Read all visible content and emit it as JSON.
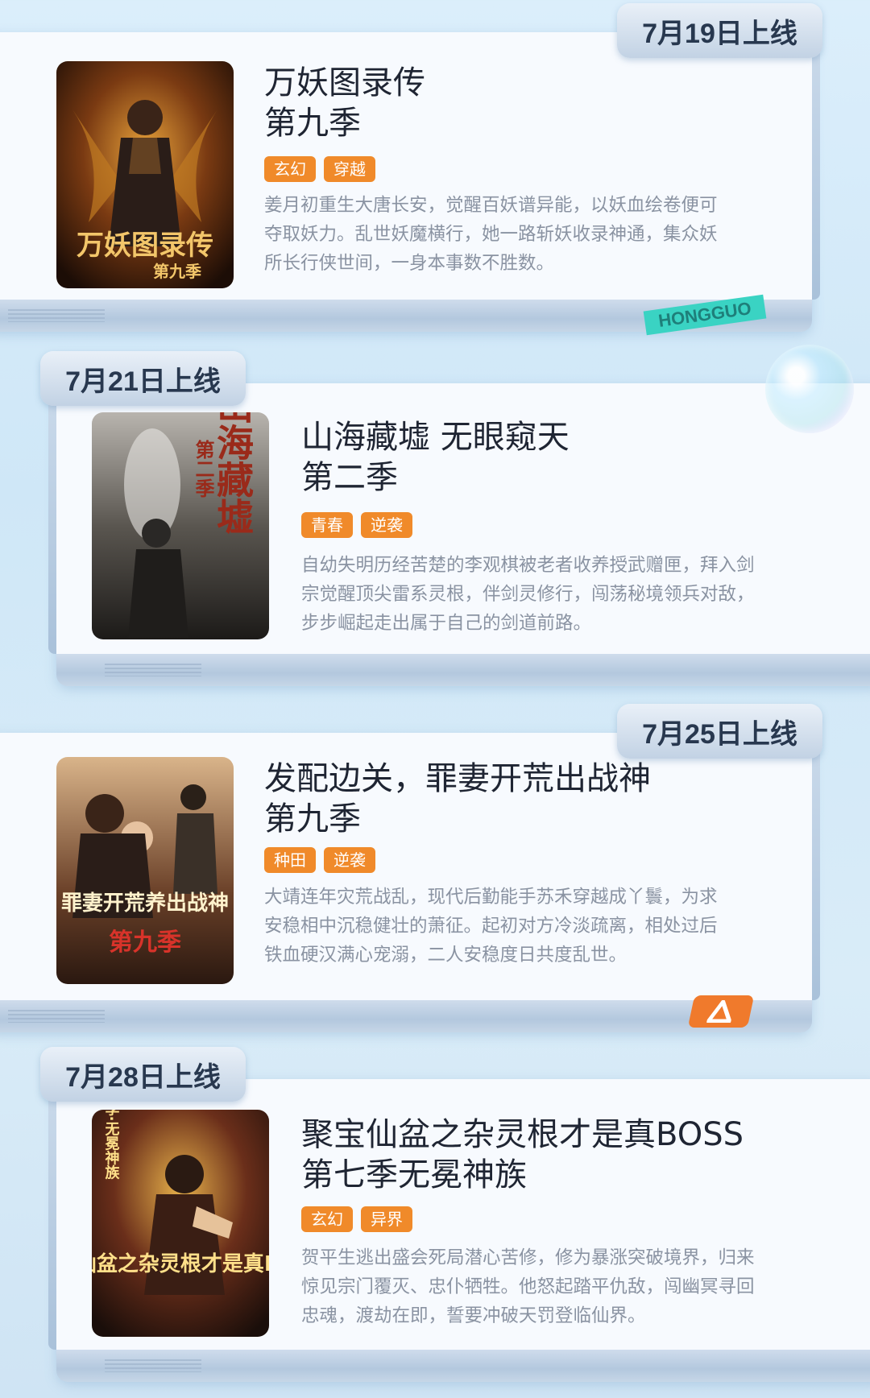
{
  "cards": [
    {
      "date": "7月19日上线",
      "title_line1": "万妖图录传",
      "title_line2": "第九季",
      "tags": [
        "玄幻",
        "穿越"
      ],
      "desc_lines": [
        "姜月初重生大唐长安，觉醒百妖谱异能，以妖血绘卷便可",
        "夺取妖力。乱世妖魔横行，她一路斩妖收录神通，集众妖",
        "所长行侠世间，一身本事数不胜数。"
      ],
      "cover_text": "万妖图录传",
      "cover_sub": "第九季"
    },
    {
      "date": "7月21日上线",
      "title_line1": "山海藏墟 无眼窥天",
      "title_line2": "第二季",
      "tags": [
        "青春",
        "逆袭"
      ],
      "desc_lines": [
        "自幼失明历经苦楚的李观棋被老者收养授武赠匣，拜入剑",
        "宗觉醒顶尖雷系灵根，伴剑灵修行，闯荡秘境领兵对敌，",
        "步步崛起走出属于自己的剑道前路。"
      ],
      "cover_text": "山海藏墟",
      "cover_sub": "第二季"
    },
    {
      "date": "7月25日上线",
      "title_line1": "发配边关，罪妻开荒出战神",
      "title_line2": "第九季",
      "tags": [
        "种田",
        "逆袭"
      ],
      "desc_lines": [
        "大靖连年灾荒战乱，现代后勤能手苏禾穿越成丫鬟，为求",
        "安稳相中沉稳健壮的萧征。起初对方冷淡疏离，相处过后",
        "铁血硬汉满心宠溺，二人安稳度日共度乱世。"
      ],
      "cover_text": "罪妻开荒养出战神",
      "cover_sub": "第九季"
    },
    {
      "date": "7月28日上线",
      "title_line1": "聚宝仙盆之杂灵根才是真BOSS",
      "title_line2": "第七季无冕神族",
      "tags": [
        "玄幻",
        "异界"
      ],
      "desc_lines": [
        "贺平生逃出盛会死局潜心苦修，修为暴涨突破境界，归来",
        "惊见宗门覆灭、忠仆牺牲。他怒起踏平仇敌，闯幽冥寻回",
        "忠魂，渡劫在即，誓要冲破天罚登临仙界。"
      ],
      "cover_text": "聚宝仙盆之杂灵根才是真BOSS",
      "cover_sub": "第七季·无冕神族"
    }
  ],
  "brand": "HONGGUO",
  "colors": {
    "tag": "#f08a2a",
    "title": "#1f2533",
    "desc": "#8a93a2",
    "tab_text": "#28384f"
  }
}
